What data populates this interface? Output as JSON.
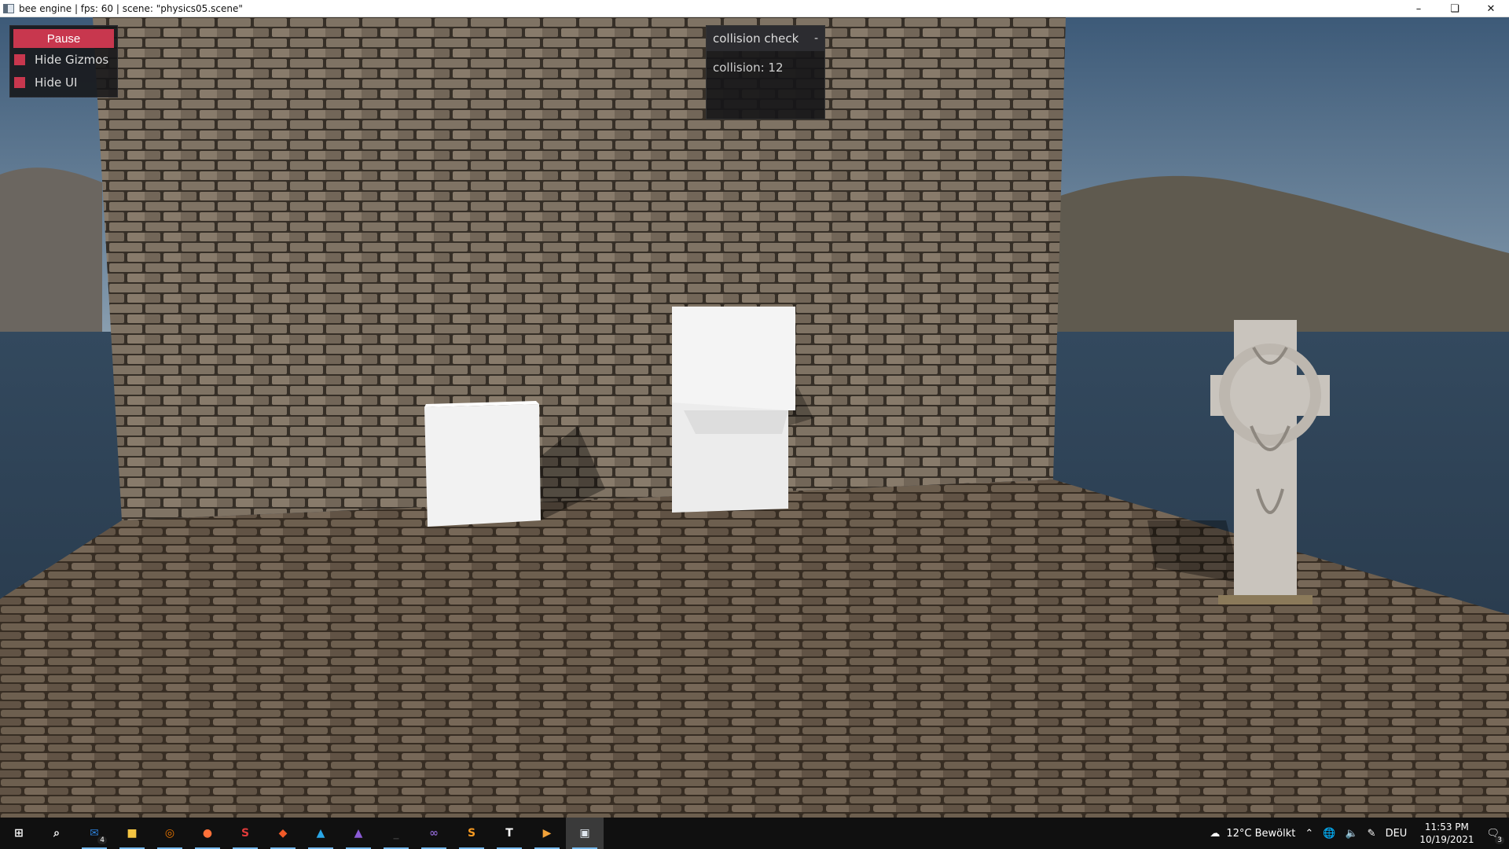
{
  "window": {
    "title": "bee engine | fps: 60 | scene: \"physics05.scene\"",
    "controls": {
      "minimize": "–",
      "restore": "❏",
      "close": "✕"
    }
  },
  "engine_ui": {
    "pause_label": "Pause",
    "hide_gizmos_label": "Hide Gizmos",
    "hide_ui_label": "Hide UI",
    "accent_color": "#c8374e"
  },
  "collision_panel": {
    "title": "collision check",
    "collapse_symbol": "-",
    "value_text": "collision: 12"
  },
  "taskbar": {
    "apps": [
      {
        "name": "start-button",
        "glyph": "⊞",
        "color": "#ffffff"
      },
      {
        "name": "search-icon",
        "glyph": "⌕",
        "color": "#ffffff"
      },
      {
        "name": "mail-icon",
        "glyph": "✉",
        "color": "#2b7cd3",
        "badge": "4"
      },
      {
        "name": "file-explorer-icon",
        "glyph": "■",
        "color": "#f4c542"
      },
      {
        "name": "blender-icon",
        "glyph": "◎",
        "color": "#ea7600"
      },
      {
        "name": "firefox-icon",
        "glyph": "●",
        "color": "#ff7139"
      },
      {
        "name": "app-s-icon",
        "glyph": "S",
        "color": "#e03a3a"
      },
      {
        "name": "app-orange-icon",
        "glyph": "◆",
        "color": "#f05a28"
      },
      {
        "name": "affinity-designer-icon",
        "glyph": "▲",
        "color": "#2aa7e8"
      },
      {
        "name": "affinity-photo-icon",
        "glyph": "▲",
        "color": "#8b5bd6"
      },
      {
        "name": "terminal-icon",
        "glyph": "_",
        "color": "#3c3c3c"
      },
      {
        "name": "visual-studio-icon",
        "glyph": "∞",
        "color": "#8661c5"
      },
      {
        "name": "sublime-text-icon",
        "glyph": "S",
        "color": "#f79a22"
      },
      {
        "name": "typora-icon",
        "glyph": "T",
        "color": "#ffffff"
      },
      {
        "name": "media-player-icon",
        "glyph": "▶",
        "color": "#f2a33a"
      },
      {
        "name": "bee-engine-taskbar-icon",
        "glyph": "▣",
        "color": "#dfe6ee"
      }
    ],
    "tray": {
      "weather": "12°C  Bewölkt",
      "language": "DEU",
      "time": "11:53 PM",
      "date": "10/19/2021",
      "notification_count": "3"
    }
  }
}
